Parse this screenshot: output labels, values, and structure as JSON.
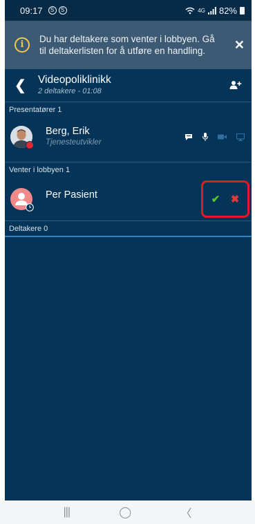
{
  "status_bar": {
    "time": "09:17",
    "left_icons": [
      "S",
      "S"
    ],
    "network": "4G",
    "battery": "82%"
  },
  "banner": {
    "message": "Du har deltakere som venter i lobbyen. Gå til deltakerlisten for å utføre en handling.",
    "info_icon": "i",
    "close_icon": "✕"
  },
  "header": {
    "back_icon": "❮",
    "title": "Videopoliklinikk",
    "subtitle": "2 deltakere - 01:08"
  },
  "sections": {
    "presenters": "Presentatører 1",
    "lobby": "Venter i lobbyen 1",
    "participants": "Deltakere 0"
  },
  "presenter": {
    "name": "Berg, Erik",
    "role": "Tjenesteutvikler"
  },
  "lobby_person": {
    "name": "Per Pasient",
    "accept_icon": "✔",
    "reject_icon": "✖"
  },
  "nav": {
    "recents_icon": "|||",
    "home_icon": "◯",
    "back_icon": "〈"
  },
  "colors": {
    "background": "#043457",
    "banner": "#3c5a74",
    "accent": "#2e84c5",
    "accept": "#58c72b",
    "reject": "#e03a3a",
    "highlight_outline": "#e01b24"
  }
}
